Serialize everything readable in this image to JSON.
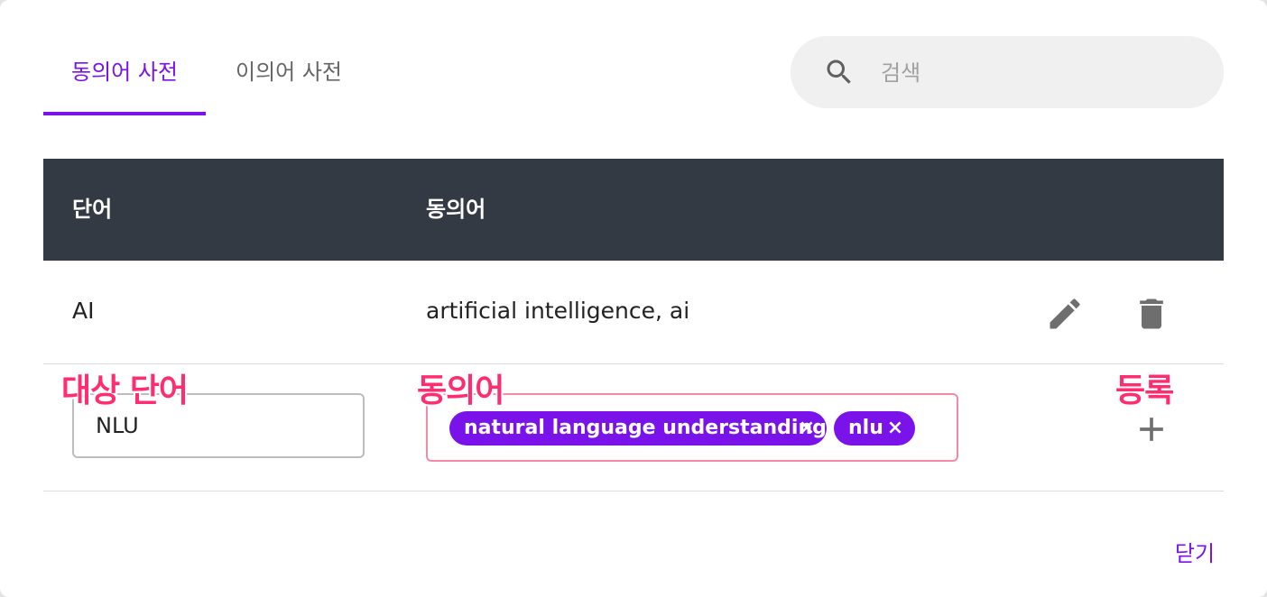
{
  "tabs": [
    {
      "label": "동의어 사전",
      "active": true
    },
    {
      "label": "이의어 사전",
      "active": false
    }
  ],
  "search": {
    "placeholder": "검색",
    "icon": "search-icon"
  },
  "table": {
    "headers": [
      "단어",
      "동의어"
    ],
    "rows": [
      {
        "word": "AI",
        "synonyms": "artificial intelligence, ai",
        "actions": [
          "edit-icon",
          "delete-icon"
        ]
      }
    ]
  },
  "form": {
    "annotations": {
      "target_word": "대상 단어",
      "synonym": "동의어",
      "register": "등록"
    },
    "word_value": "NLU",
    "chips": [
      {
        "label": "natural language understanding",
        "remove": "×"
      },
      {
        "label": "nlu",
        "remove": "×"
      }
    ],
    "add_icon": "plus-icon"
  },
  "close_label": "닫기",
  "colors": {
    "accent": "#7a13ea",
    "header_bg": "#343a43",
    "annotation": "#ff2d6f",
    "field_error_border": "#f48aa8"
  }
}
